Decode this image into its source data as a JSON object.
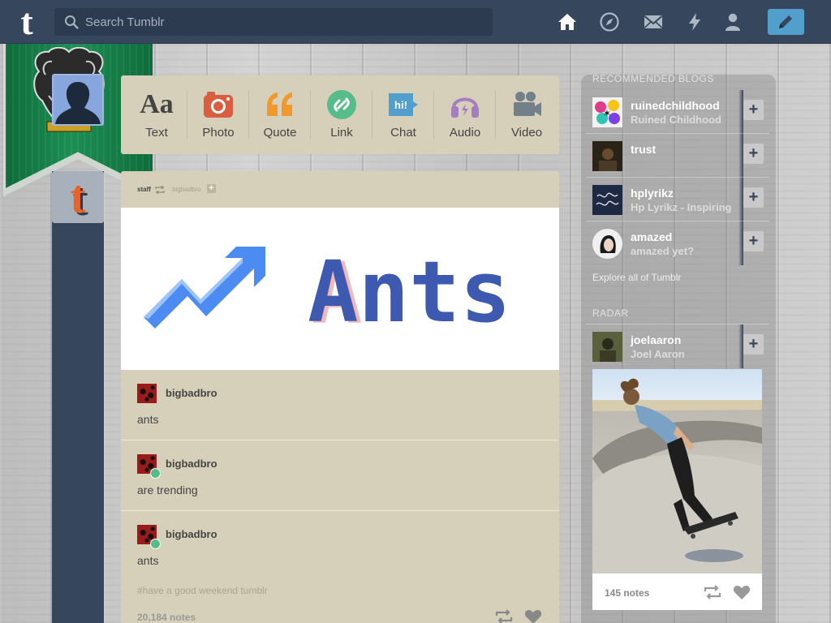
{
  "header": {
    "logo": "t",
    "search_placeholder": "Search Tumblr"
  },
  "composer": {
    "types": [
      {
        "label": "Text",
        "icon": "text-icon",
        "glyph": "Aa",
        "color": "#444444"
      },
      {
        "label": "Photo",
        "icon": "camera-icon",
        "color": "#d95e40"
      },
      {
        "label": "Quote",
        "icon": "quote-icon",
        "glyph": "“",
        "color": "#f2992e"
      },
      {
        "label": "Link",
        "icon": "link-icon",
        "color": "#56bc8a"
      },
      {
        "label": "Chat",
        "icon": "chat-icon",
        "glyph": "hi!",
        "color": "#529ecc"
      },
      {
        "label": "Audio",
        "icon": "headphones-icon",
        "color": "#a77dc2"
      },
      {
        "label": "Video",
        "icon": "video-camera-icon",
        "color": "#748089"
      }
    ]
  },
  "post": {
    "author": "staff",
    "reblogged_from": "bigbadbro",
    "image_text": "Ants",
    "thread": [
      {
        "blog": "bigbadbro",
        "text": "ants",
        "reblog": false
      },
      {
        "blog": "bigbadbro",
        "text": "are trending",
        "reblog": true
      },
      {
        "blog": "bigbadbro",
        "text": "ants",
        "reblog": true
      }
    ],
    "tags": "#have a good weekend tumblr",
    "notes": "20,184 notes"
  },
  "sidebar": {
    "recommended_title": "RECOMMENDED BLOGS",
    "recommended": [
      {
        "name": "ruinedchildhood",
        "title": "Ruined Childhood"
      },
      {
        "name": "trust",
        "title": ""
      },
      {
        "name": "hplyrikz",
        "title": "Hp Lyrikz - Inspiring"
      },
      {
        "name": "amazed",
        "title": "amazed yet?"
      }
    ],
    "explore": "Explore all of Tumblr",
    "radar_title": "RADAR",
    "radar": {
      "name": "joelaaron",
      "title": "Joel Aaron",
      "notes": "145 notes"
    }
  },
  "colors": {
    "header": "#36465d",
    "post_bg": "#d6cfb9",
    "compose": "#529ecc",
    "banner_green": "#1c8f54"
  }
}
